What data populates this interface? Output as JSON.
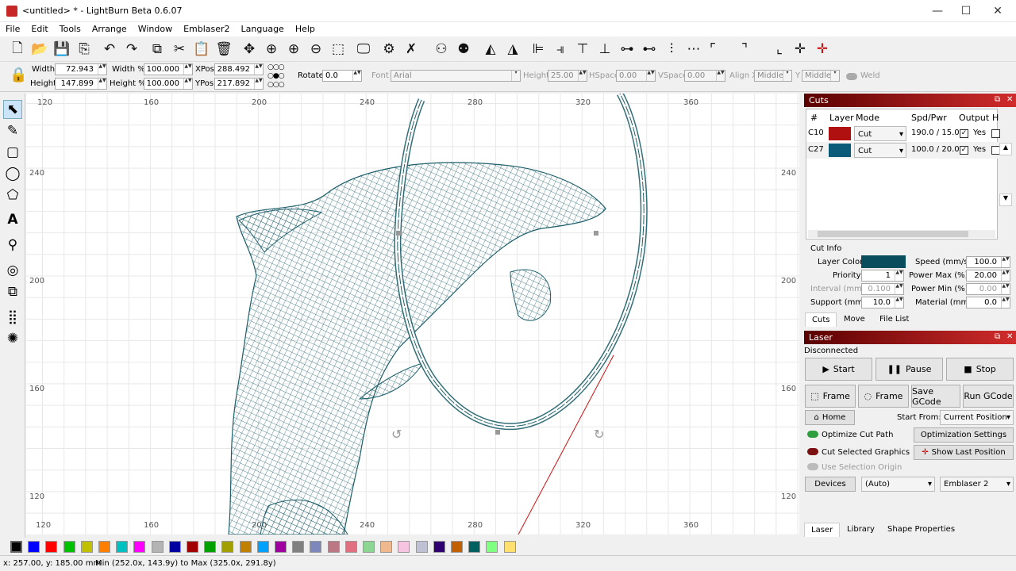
{
  "window": {
    "title": "<untitled> * - LightBurn Beta 0.6.07",
    "min": "—",
    "max": "☐",
    "close": "✕"
  },
  "menu": [
    "File",
    "Edit",
    "Tools",
    "Arrange",
    "Window",
    "Emblaser2",
    "Language",
    "Help"
  ],
  "props": {
    "width_label": "Width",
    "width_value": "72.943",
    "height_label": "Height",
    "height_value": "147.899",
    "widthpct_label": "Width %",
    "widthpct_value": "100.000",
    "heightpct_label": "Height %",
    "heightpct_value": "100.000",
    "xpos_label": "XPos",
    "xpos_value": "288.492",
    "ypos_label": "YPos",
    "ypos_value": "217.892",
    "rotate_label": "Rotate",
    "rotate_value": "0.0",
    "font_label": "Font",
    "font_value": "Arial",
    "fheight_label": "Height",
    "fheight_value": "25.00",
    "hspace_label": "HSpace",
    "hspace_value": "0.00",
    "vspace_label": "VSpace",
    "vspace_value": "0.00",
    "alignx_label": "Align X",
    "alignx_value": "Middle",
    "y_label": "Y",
    "y_value": "Middle",
    "weld_label": "Weld"
  },
  "ruler": {
    "top": [
      "120",
      "160",
      "200",
      "240",
      "280",
      "320",
      "360"
    ],
    "bottom": [
      "120",
      "160",
      "200",
      "240",
      "280",
      "320",
      "360"
    ],
    "left": [
      "240",
      "200",
      "160",
      "120"
    ],
    "right": [
      "240",
      "200",
      "160",
      "120"
    ]
  },
  "cuts": {
    "title": "Cuts",
    "headers": [
      "#",
      "Layer",
      "Mode",
      "Spd/Pwr",
      "Output",
      "H"
    ],
    "rows": [
      {
        "id": "C10",
        "color": "#b01010",
        "mode": "Cut",
        "spdpwr": "190.0 / 15.0",
        "output": "Yes"
      },
      {
        "id": "C27",
        "color": "#0a5a7a",
        "mode": "Cut",
        "spdpwr": "100.0 / 20.0",
        "output": "Yes"
      }
    ]
  },
  "cutinfo": {
    "title": "Cut Info",
    "layer_color_label": "Layer Color",
    "layer_color": "#0a4d5c",
    "speed_label": "Speed (mm/s)",
    "speed_value": "100.0",
    "priority_label": "Priority",
    "priority_value": "1",
    "powermax_label": "Power Max (%)",
    "powermax_value": "20.00",
    "interval_label": "Interval (mm)",
    "interval_value": "0.100",
    "powermin_label": "Power Min (%)",
    "powermin_value": "0.00",
    "support_label": "Support (mm)",
    "support_value": "10.0",
    "material_label": "Material (mm)",
    "material_value": "0.0"
  },
  "cutstabs": [
    "Cuts",
    "Move",
    "File List"
  ],
  "laser": {
    "title": "Laser",
    "status": "Disconnected",
    "start": "Start",
    "pause": "Pause",
    "stop": "Stop",
    "frame1": "Frame",
    "frame2": "Frame",
    "savegcode": "Save GCode",
    "rungcode": "Run GCode",
    "home": "Home",
    "startfrom_label": "Start From:",
    "startfrom_value": "Current Position",
    "optimize": "Optimize Cut Path",
    "optsettings": "Optimization Settings",
    "cutselected": "Cut Selected Graphics",
    "showlast": "Show Last Position",
    "useselection": "Use Selection Origin",
    "devices": "Devices",
    "auto": "(Auto)",
    "device": "Emblaser 2"
  },
  "bottomtabs": [
    "Laser",
    "Library",
    "Shape Properties"
  ],
  "palette": [
    "#000000",
    "#0000ff",
    "#ff0000",
    "#00c000",
    "#c0c000",
    "#ff8000",
    "#00c0c0",
    "#ff00ff",
    "#b4b4b4",
    "#0000a0",
    "#a00000",
    "#00a000",
    "#a0a000",
    "#c08000",
    "#00a0ff",
    "#a000a0",
    "#808080",
    "#7d87b9",
    "#bb7784",
    "#e07080",
    "#8dd593",
    "#f0b98d",
    "#f6c4e1",
    "#bec1d4",
    "#300070",
    "#c06000",
    "#006060",
    "#80ff80",
    "#ffe070"
  ],
  "status": {
    "coords": "x: 257.00, y: 185.00 mm",
    "bounds": "Min (252.0x, 143.9y) to Max (325.0x, 291.8y)"
  }
}
